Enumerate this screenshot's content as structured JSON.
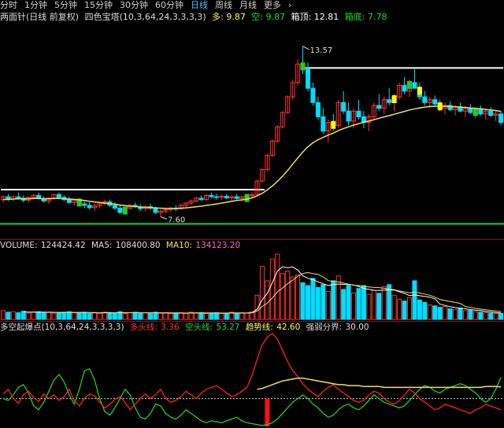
{
  "tabs": [
    {
      "label": "分时",
      "active": false
    },
    {
      "label": "1分钟",
      "active": false
    },
    {
      "label": "5分钟",
      "active": false
    },
    {
      "label": "15分钟",
      "active": false
    },
    {
      "label": "30分钟",
      "active": false
    },
    {
      "label": "60分钟",
      "active": false
    },
    {
      "label": "日线",
      "active": true
    },
    {
      "label": "周线",
      "active": false
    },
    {
      "label": "月线",
      "active": false
    },
    {
      "label": "更多",
      "active": false
    }
  ],
  "more_chevron": "›",
  "indicator": {
    "name": "两面针(日线 前复权)",
    "formula": "四色宝塔(10,3,64,24,3,3,3,3)",
    "long_label": "多:",
    "long_value": "9.87",
    "short_label": "空:",
    "short_value": "9.87",
    "box_top_label": "箱顶:",
    "box_top_value": "12.81",
    "box_bottom_label": "箱底:",
    "box_bottom_value": "7.78"
  },
  "price_marks": {
    "high": "13.57",
    "low": "7.60"
  },
  "volume_header": {
    "vol_label": "VOLUME:",
    "vol_value": "124424.42",
    "ma5_label": "MA5:",
    "ma5_value": "108400.80",
    "ma10_label": "MA10:",
    "ma10_value": "134123.20"
  },
  "osc_header": {
    "name": "多空起爆点(10,3,64,24,3,3,3,3)",
    "l1_label": "多头线:",
    "l1_value": "3.36",
    "l2_label": "空头线:",
    "l2_value": "53.27",
    "l3_label": "趋势线:",
    "l3_value": "42.60",
    "l4_label": "强弱分界:",
    "l4_value": "30.00"
  },
  "colors": {
    "up": "#ff3333",
    "down": "#00ddff",
    "ma": "#f0e060",
    "box": "#ffffff",
    "green": "#22cc22",
    "yellow": "#ffff00",
    "tab_active": "#44c6ff",
    "label": "#dddddd",
    "ma10": "#ff66cc"
  },
  "chart_data": {
    "type": "candlestick",
    "price_range": [
      7.2,
      14.2
    ],
    "dates_count": 99,
    "ohlc": [
      [
        8.2,
        8.35,
        8.1,
        8.3
      ],
      [
        8.3,
        8.4,
        8.15,
        8.22
      ],
      [
        8.22,
        8.35,
        8.15,
        8.3
      ],
      [
        8.3,
        8.45,
        8.2,
        8.25
      ],
      [
        8.25,
        8.35,
        8.1,
        8.18
      ],
      [
        8.18,
        8.3,
        8.1,
        8.28
      ],
      [
        8.28,
        8.4,
        8.2,
        8.35
      ],
      [
        8.35,
        8.45,
        8.2,
        8.24
      ],
      [
        8.24,
        8.3,
        8.1,
        8.15
      ],
      [
        8.15,
        8.28,
        8.05,
        8.25
      ],
      [
        8.25,
        8.4,
        8.2,
        8.38
      ],
      [
        8.38,
        8.45,
        8.25,
        8.28
      ],
      [
        8.28,
        8.35,
        8.15,
        8.2
      ],
      [
        8.2,
        8.3,
        8.05,
        8.1
      ],
      [
        8.1,
        8.22,
        8.0,
        8.18
      ],
      [
        8.18,
        8.25,
        8.0,
        8.05
      ],
      [
        8.05,
        8.15,
        7.9,
        8.0
      ],
      [
        8.0,
        8.1,
        7.85,
        7.92
      ],
      [
        7.92,
        8.05,
        7.8,
        7.98
      ],
      [
        7.98,
        8.1,
        7.9,
        8.06
      ],
      [
        8.06,
        8.2,
        8.0,
        8.12
      ],
      [
        8.12,
        8.2,
        7.95,
        8.0
      ],
      [
        8.0,
        8.1,
        7.85,
        7.9
      ],
      [
        7.9,
        8.0,
        7.7,
        7.75
      ],
      [
        7.75,
        7.95,
        7.7,
        7.9
      ],
      [
        7.9,
        8.05,
        7.85,
        8.0
      ],
      [
        8.0,
        8.1,
        7.9,
        7.95
      ],
      [
        7.95,
        8.05,
        7.8,
        7.88
      ],
      [
        7.88,
        8.0,
        7.8,
        7.95
      ],
      [
        7.95,
        8.05,
        7.85,
        7.9
      ],
      [
        7.9,
        7.95,
        7.7,
        7.75
      ],
      [
        7.75,
        7.85,
        7.6,
        7.8
      ],
      [
        7.8,
        7.9,
        7.72,
        7.85
      ],
      [
        7.85,
        7.95,
        7.75,
        7.9
      ],
      [
        7.9,
        8.0,
        7.8,
        7.88
      ],
      [
        7.88,
        8.05,
        7.85,
        8.0
      ],
      [
        8.0,
        8.1,
        7.9,
        8.08
      ],
      [
        8.08,
        8.2,
        8.0,
        8.15
      ],
      [
        8.15,
        8.3,
        8.1,
        8.25
      ],
      [
        8.25,
        8.35,
        8.15,
        8.2
      ],
      [
        8.2,
        8.4,
        8.18,
        8.35
      ],
      [
        8.35,
        8.45,
        8.25,
        8.3
      ],
      [
        8.3,
        8.4,
        8.2,
        8.28
      ],
      [
        8.28,
        8.38,
        8.2,
        8.32
      ],
      [
        8.32,
        8.4,
        8.22,
        8.26
      ],
      [
        8.26,
        8.36,
        8.18,
        8.3
      ],
      [
        8.3,
        8.4,
        8.2,
        8.24
      ],
      [
        8.24,
        8.35,
        8.15,
        8.3
      ],
      [
        8.3,
        8.4,
        8.25,
        8.34
      ],
      [
        8.34,
        8.45,
        8.28,
        8.38
      ],
      [
        8.38,
        8.9,
        8.35,
        8.85
      ],
      [
        8.85,
        9.3,
        8.8,
        9.25
      ],
      [
        9.25,
        9.8,
        9.2,
        9.75
      ],
      [
        9.75,
        10.3,
        9.7,
        10.25
      ],
      [
        10.25,
        10.8,
        10.2,
        10.75
      ],
      [
        10.75,
        11.3,
        10.7,
        11.25
      ],
      [
        11.25,
        11.85,
        11.2,
        11.8
      ],
      [
        11.8,
        12.4,
        11.7,
        12.3
      ],
      [
        12.3,
        13.1,
        12.2,
        12.95
      ],
      [
        12.95,
        13.57,
        12.6,
        12.8
      ],
      [
        12.8,
        13.0,
        12.0,
        12.1
      ],
      [
        12.1,
        12.3,
        11.5,
        11.6
      ],
      [
        11.6,
        11.8,
        11.0,
        11.1
      ],
      [
        11.1,
        11.4,
        10.5,
        10.6
      ],
      [
        10.6,
        11.0,
        10.2,
        10.9
      ],
      [
        10.9,
        11.2,
        10.6,
        10.8
      ],
      [
        10.8,
        11.7,
        10.7,
        11.6
      ],
      [
        11.6,
        12.0,
        11.2,
        11.3
      ],
      [
        11.3,
        11.6,
        10.8,
        10.95
      ],
      [
        10.95,
        11.4,
        10.7,
        11.3
      ],
      [
        11.3,
        11.7,
        11.0,
        11.1
      ],
      [
        11.1,
        11.3,
        10.7,
        10.9
      ],
      [
        10.9,
        11.2,
        10.6,
        11.1
      ],
      [
        11.1,
        11.6,
        11.0,
        11.5
      ],
      [
        11.5,
        11.9,
        11.3,
        11.4
      ],
      [
        11.4,
        11.8,
        11.2,
        11.7
      ],
      [
        11.7,
        12.1,
        11.5,
        11.6
      ],
      [
        11.6,
        11.9,
        11.3,
        11.8
      ],
      [
        11.8,
        12.3,
        11.7,
        12.2
      ],
      [
        12.2,
        12.5,
        11.9,
        12.0
      ],
      [
        12.0,
        12.4,
        11.8,
        12.3
      ],
      [
        12.3,
        12.81,
        12.1,
        12.1
      ],
      [
        12.1,
        12.3,
        11.7,
        11.8
      ],
      [
        11.8,
        12.0,
        11.5,
        11.6
      ],
      [
        11.6,
        11.8,
        11.4,
        11.7
      ],
      [
        11.7,
        11.85,
        11.45,
        11.55
      ],
      [
        11.55,
        11.7,
        11.3,
        11.4
      ],
      [
        11.4,
        11.6,
        11.2,
        11.5
      ],
      [
        11.5,
        11.65,
        11.3,
        11.35
      ],
      [
        11.35,
        11.5,
        11.15,
        11.45
      ],
      [
        11.45,
        11.6,
        11.25,
        11.3
      ],
      [
        11.3,
        11.45,
        11.1,
        11.4
      ],
      [
        11.4,
        11.55,
        11.2,
        11.25
      ],
      [
        11.25,
        11.4,
        11.05,
        11.35
      ],
      [
        11.35,
        11.5,
        11.15,
        11.2
      ],
      [
        11.2,
        11.35,
        11.0,
        11.3
      ],
      [
        11.3,
        11.45,
        11.1,
        11.15
      ],
      [
        11.15,
        11.3,
        10.95,
        11.2
      ],
      [
        11.2,
        11.3,
        10.8,
        10.9
      ]
    ],
    "ma": [
      8.2,
      8.21,
      8.22,
      8.23,
      8.23,
      8.23,
      8.24,
      8.24,
      8.23,
      8.23,
      8.24,
      8.24,
      8.23,
      8.22,
      8.21,
      8.19,
      8.17,
      8.14,
      8.12,
      8.1,
      8.08,
      8.06,
      8.04,
      8.01,
      7.99,
      7.97,
      7.96,
      7.94,
      7.93,
      7.92,
      7.91,
      7.9,
      7.89,
      7.89,
      7.89,
      7.9,
      7.91,
      7.93,
      7.95,
      7.97,
      8.0,
      8.02,
      8.05,
      8.08,
      8.11,
      8.14,
      8.17,
      8.19,
      8.22,
      8.26,
      8.33,
      8.42,
      8.54,
      8.68,
      8.84,
      9.02,
      9.22,
      9.44,
      9.66,
      9.87,
      10.05,
      10.19,
      10.3,
      10.38,
      10.46,
      10.53,
      10.62,
      10.69,
      10.75,
      10.81,
      10.86,
      10.91,
      10.95,
      11.0,
      11.05,
      11.1,
      11.14,
      11.19,
      11.24,
      11.29,
      11.34,
      11.38,
      11.41,
      11.44,
      11.46,
      11.47,
      11.47,
      11.47,
      11.46,
      11.45,
      11.44,
      11.43,
      11.41,
      11.4,
      11.38,
      11.36,
      11.34,
      11.32,
      11.29
    ],
    "box_segments": [
      {
        "from": 0,
        "to": 51,
        "value": 8.55
      },
      {
        "from": 59,
        "to": 98,
        "value": 12.81
      }
    ],
    "support_value": 7.35,
    "markers": [
      {
        "i": 15,
        "color": "green"
      },
      {
        "i": 24,
        "color": "green"
      },
      {
        "i": 48,
        "color": "green"
      },
      {
        "i": 59,
        "color": "green"
      },
      {
        "i": 65,
        "color": "yellow"
      },
      {
        "i": 77,
        "color": "yellow"
      },
      {
        "i": 80,
        "color": "green"
      },
      {
        "i": 82,
        "color": "yellow"
      },
      {
        "i": 86,
        "color": "yellow"
      },
      {
        "i": 93,
        "color": "green"
      }
    ],
    "volume_range": [
      0,
      140000
    ],
    "volume": [
      18000,
      15000,
      16000,
      14000,
      17000,
      13000,
      15000,
      16000,
      14000,
      15000,
      13000,
      14000,
      15000,
      16000,
      14000,
      13000,
      15000,
      12000,
      14000,
      13000,
      15000,
      14000,
      13000,
      16000,
      12000,
      14000,
      15000,
      13000,
      14000,
      12000,
      15000,
      13000,
      14000,
      12000,
      13000,
      14000,
      12000,
      15000,
      13000,
      14000,
      12000,
      13000,
      14000,
      12000,
      13000,
      15000,
      12000,
      14000,
      13000,
      16000,
      50000,
      110000,
      80000,
      125000,
      135000,
      95000,
      100000,
      88000,
      92000,
      76000,
      70000,
      85000,
      66000,
      72000,
      58000,
      80000,
      90000,
      62000,
      70000,
      55000,
      64000,
      70000,
      52000,
      60000,
      54000,
      68000,
      72000,
      50000,
      42000,
      38000,
      45000,
      80000,
      40000,
      35000,
      30000,
      28000,
      25000,
      27000,
      22000,
      20000,
      23000,
      18000,
      19000,
      16000,
      15000,
      14000,
      13000,
      12000,
      12442
    ],
    "osc_range": [
      0,
      100
    ],
    "osc_threshold": 30,
    "osc_long": [
      35,
      40,
      30,
      25,
      34,
      38,
      31,
      27,
      35,
      30,
      34,
      28,
      32,
      40,
      28,
      22,
      30,
      35,
      33,
      26,
      20,
      24,
      29,
      32,
      26,
      18,
      24,
      30,
      35,
      30,
      34,
      40,
      30,
      26,
      28,
      32,
      38,
      34,
      30,
      36,
      40,
      42,
      44,
      40,
      36,
      32,
      34,
      38,
      42,
      55,
      72,
      88,
      96,
      100,
      94,
      82,
      70,
      60,
      54,
      46,
      40,
      36,
      32,
      38,
      42,
      45,
      40,
      36,
      32,
      28,
      26,
      28,
      34,
      38,
      36,
      30,
      26,
      24,
      28,
      34,
      40,
      36,
      30,
      26,
      22,
      18,
      20,
      24,
      22,
      20,
      18,
      16,
      14,
      18,
      20,
      24,
      22,
      20,
      18
    ],
    "osc_short": [
      30,
      28,
      34,
      42,
      45,
      36,
      22,
      18,
      26,
      38,
      50,
      56,
      48,
      34,
      24,
      40,
      60,
      62,
      50,
      30,
      16,
      12,
      20,
      30,
      40,
      34,
      20,
      10,
      8,
      14,
      24,
      22,
      14,
      10,
      8,
      12,
      18,
      14,
      10,
      6,
      4,
      6,
      5,
      4,
      6,
      8,
      10,
      6,
      4,
      3,
      2,
      1,
      2,
      4,
      8,
      14,
      20,
      26,
      30,
      34,
      30,
      24,
      20,
      14,
      10,
      12,
      18,
      22,
      24,
      20,
      18,
      22,
      28,
      34,
      30,
      26,
      24,
      22,
      20,
      22,
      28,
      34,
      40,
      44,
      42,
      38,
      36,
      40,
      42,
      44,
      46,
      44,
      40,
      36,
      30,
      26,
      30,
      40,
      53
    ],
    "osc_trend": [
      null,
      null,
      null,
      null,
      null,
      null,
      null,
      null,
      null,
      null,
      null,
      null,
      null,
      null,
      null,
      null,
      null,
      null,
      null,
      null,
      null,
      null,
      null,
      null,
      null,
      null,
      null,
      null,
      null,
      null,
      null,
      null,
      null,
      null,
      null,
      null,
      null,
      null,
      null,
      null,
      null,
      null,
      null,
      null,
      null,
      null,
      null,
      null,
      null,
      null,
      40,
      41,
      43,
      45,
      47,
      49,
      50,
      51,
      52,
      52,
      51,
      50,
      49,
      48,
      47,
      46,
      45,
      45,
      44,
      44,
      44,
      43,
      43,
      43,
      43,
      42,
      42,
      42,
      42,
      42,
      42,
      42,
      42,
      42,
      42,
      42,
      42,
      42,
      42,
      42,
      42,
      42,
      42,
      42,
      42,
      43,
      43,
      43,
      42.6
    ],
    "osc_bar_index": 52
  }
}
